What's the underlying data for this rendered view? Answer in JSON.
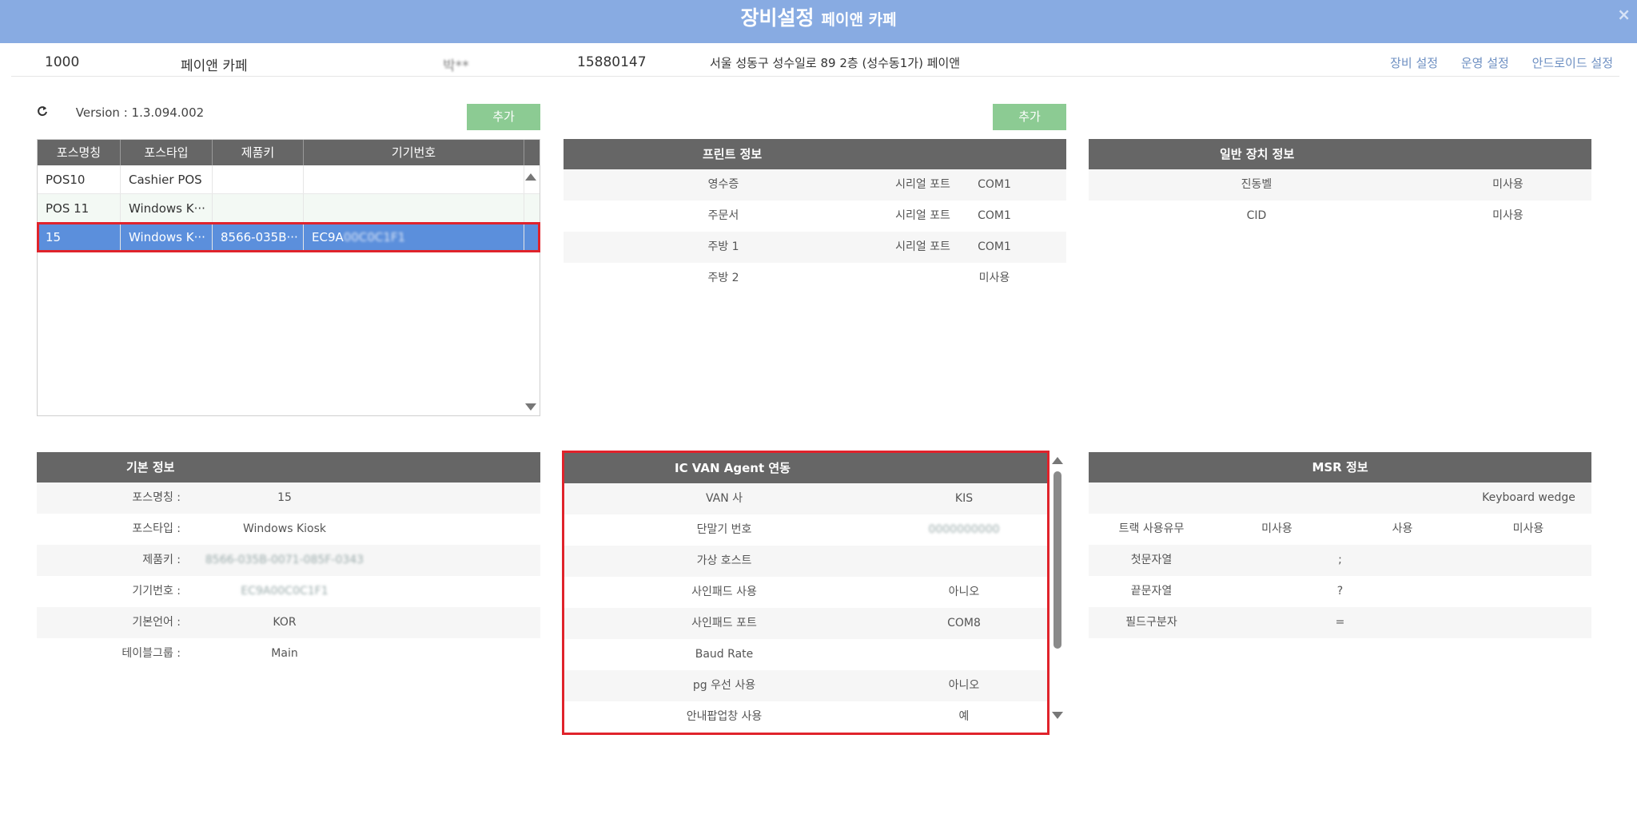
{
  "window": {
    "title": "장비설정",
    "subtitle": "페이앤 카페",
    "close": "×"
  },
  "store": {
    "code": "1000",
    "name": "페이앤 카페",
    "owner": "박**",
    "phone": "15880147",
    "address": "서울 성동구 성수일로 89 2층 (성수동1가) 페이앤",
    "links": [
      "장비 설정",
      "운영 설정",
      "안드로이드 설정"
    ]
  },
  "version": {
    "refresh_icon": "refresh-icon",
    "label": "Version : 1.3.094.002"
  },
  "buttons": {
    "add_left": "추가",
    "add_mid": "추가"
  },
  "pos_table": {
    "headers": [
      "포스명칭",
      "포스타입",
      "제품키",
      "기기번호"
    ],
    "rows": [
      [
        "POS10",
        "Cashier POS",
        "",
        ""
      ],
      [
        "POS 11",
        "Windows K···",
        "",
        ""
      ],
      [
        "15",
        "Windows K···",
        "8566-035B···",
        "EC9A"
      ]
    ],
    "row3_masked_suffix": "00C0C1F1"
  },
  "print_info": {
    "title": "프린트 정보",
    "rows": [
      [
        "영수증",
        "시리얼 포트",
        "COM1"
      ],
      [
        "주문서",
        "시리얼 포트",
        "COM1"
      ],
      [
        "주방 1",
        "시리얼 포트",
        "COM1"
      ],
      [
        "주방 2",
        "",
        "미사용"
      ]
    ]
  },
  "general_device": {
    "title": "일반 장치 정보",
    "rows": [
      [
        "진동벨",
        "미사용"
      ],
      [
        "CID",
        "미사용"
      ]
    ]
  },
  "basic_info": {
    "title": "기본 정보",
    "rows": [
      [
        "포스명칭 :",
        "15"
      ],
      [
        "포스타입 :",
        "Windows Kiosk"
      ],
      [
        "제품키 :",
        "8566-035B-0071-085F-0343"
      ],
      [
        "기기번호 :",
        "EC9A00C0C1F1"
      ],
      [
        "기본언어 :",
        "KOR"
      ],
      [
        "테이블그룹 :",
        "Main"
      ]
    ]
  },
  "ic_van": {
    "title": "IC VAN Agent 연동",
    "rows": [
      [
        "VAN 사",
        "KIS"
      ],
      [
        "단말기 번호",
        "0000000000"
      ],
      [
        "가상 호스트",
        ""
      ],
      [
        "사인패드 사용",
        "아니오"
      ],
      [
        "사인패드 포트",
        "COM8"
      ],
      [
        "Baud Rate",
        ""
      ],
      [
        "pg 우선 사용",
        "아니오"
      ],
      [
        "안내팝업창 사용",
        "예"
      ]
    ]
  },
  "msr_info": {
    "title": "MSR 정보",
    "top_value": "Keyboard wedge",
    "track_row": [
      "트랙 사용유무",
      "미사용",
      "사용",
      "미사용"
    ],
    "rows": [
      [
        "첫문자열",
        ";"
      ],
      [
        "끝문자열",
        "?"
      ],
      [
        "필드구분자",
        "="
      ]
    ]
  },
  "colors": {
    "titlebar": "#88abe2",
    "panel_header": "#666666",
    "add_button": "#8ccb93",
    "selected_row": "#5b8fdc",
    "highlight_border": "#e0232b",
    "link": "#6d8fc2"
  }
}
